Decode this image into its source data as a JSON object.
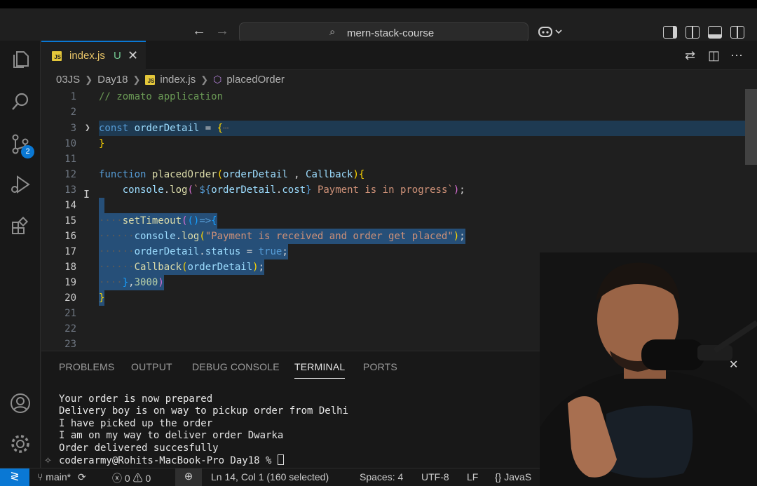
{
  "titlebar": {
    "back_arrow": "←",
    "forward_arrow": "→",
    "search_text": "mern-stack-course",
    "copilot_icon": "copilot-icon",
    "layout_icons": [
      "toggle-primary-sidebar-icon",
      "toggle-editor-layout-icon",
      "toggle-panel-icon",
      "toggle-secondary-sidebar-icon"
    ]
  },
  "activity_bar": {
    "items": [
      {
        "icon": "files-icon"
      },
      {
        "icon": "search-icon"
      },
      {
        "icon": "source-control-icon",
        "badge": "2"
      },
      {
        "icon": "run-debug-icon"
      },
      {
        "icon": "extensions-icon"
      }
    ],
    "bottom": [
      {
        "icon": "account-icon"
      },
      {
        "icon": "settings-gear-icon"
      }
    ]
  },
  "tab": {
    "filename": "index.js",
    "status": "U",
    "close": "✕"
  },
  "breadcrumb": {
    "items": [
      "03JS",
      "Day18",
      "index.js",
      "placedOrder"
    ]
  },
  "editor": {
    "lines": [
      {
        "n": "1",
        "code": "// zomato application"
      },
      {
        "n": "2",
        "code": ""
      },
      {
        "n": "3",
        "code": "const orderDetail = {⋯"
      },
      {
        "n": "10",
        "code": "}"
      },
      {
        "n": "11",
        "code": ""
      },
      {
        "n": "12",
        "code": "function placedOrder(orderDetail , Callback){"
      },
      {
        "n": "13",
        "code": "    console.log(`${orderDetail.cost} Payment is in progress`);"
      },
      {
        "n": "14",
        "code": ""
      },
      {
        "n": "15",
        "code": "    setTimeout(()=>{"
      },
      {
        "n": "16",
        "code": "      console.log(\"Payment is received and order get placed\");"
      },
      {
        "n": "17",
        "code": "      orderDetail.status = true;"
      },
      {
        "n": "18",
        "code": "      Callback(orderDetail);"
      },
      {
        "n": "19",
        "code": "    },3000)"
      },
      {
        "n": "20",
        "code": "}"
      },
      {
        "n": "21",
        "code": ""
      },
      {
        "n": "22",
        "code": ""
      },
      {
        "n": "23",
        "code": ""
      }
    ]
  },
  "panel": {
    "tabs": [
      "PROBLEMS",
      "OUTPUT",
      "DEBUG CONSOLE",
      "TERMINAL",
      "PORTS"
    ],
    "active_tab": "TERMINAL",
    "terminal_lines": [
      "Your order is now prepared",
      "Delivery boy is on way to pickup order from Delhi",
      "I have picked up the order",
      "I am on my way to deliver order Dwarka",
      "Order delivered succesfully",
      "coderarmy@Rohits-MacBook-Pro Day18 % "
    ],
    "close": "✕"
  },
  "statusbar": {
    "branch": "main*",
    "errors": "0",
    "warnings": "0",
    "position": "Ln 14, Col 1 (160 selected)",
    "spaces": "Spaces: 4",
    "encoding": "UTF-8",
    "eol": "LF",
    "language": "{} JavaS"
  },
  "colors": {
    "accent": "#0a78d4",
    "selection": "#264f78",
    "modified_file": "#e8c467",
    "untracked": "#73c991"
  }
}
